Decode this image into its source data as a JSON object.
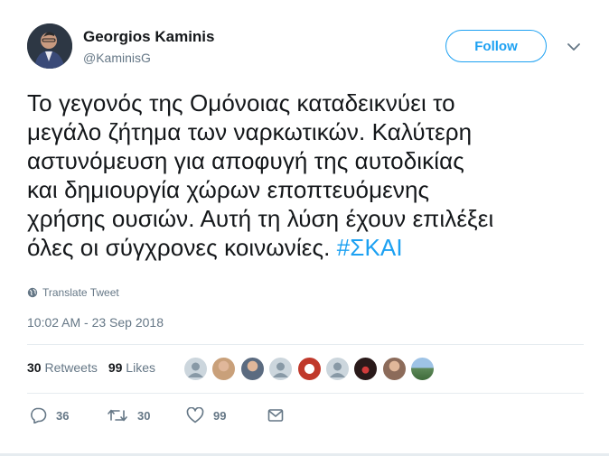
{
  "author": {
    "name": "Georgios Kaminis",
    "handle": "@KaminisG"
  },
  "follow_label": "Follow",
  "tweet": {
    "lines": [
      "Το γεγονός της Ομόνοιας καταδεικνύει το",
      "μεγάλο ζήτημα των ναρκωτικών. Καλύτερη",
      "αστυνόμευση για αποφυγή της αυτοδικίας",
      "και δημιουργία χώρων εποπτευόμενης",
      "χρήσης ουσιών. Αυτή τη λύση έχουν επιλέξει",
      "όλες οι σύγχρονες κοινωνίες."
    ],
    "hashtag": "#ΣΚΑΙ"
  },
  "translate_label": "Translate Tweet",
  "timestamp": "10:02 AM - 23 Sep 2018",
  "stats": {
    "retweets_count": "30",
    "retweets_label": "Retweets",
    "likes_count": "99",
    "likes_label": "Likes"
  },
  "liker_avatars": [
    {
      "icon": "default-avatar",
      "color": "#ccd6dd"
    },
    {
      "icon": "person-photo",
      "color": "#c9a07a"
    },
    {
      "icon": "person-photo",
      "color": "#5b6b80"
    },
    {
      "icon": "default-avatar",
      "color": "#ccd6dd"
    },
    {
      "icon": "logo-photo",
      "color": "#c0392b"
    },
    {
      "icon": "default-avatar",
      "color": "#ccd6dd"
    },
    {
      "icon": "photo-dark",
      "color": "#2a1a1a"
    },
    {
      "icon": "person-photo",
      "color": "#8c6b5a"
    },
    {
      "icon": "landscape-photo",
      "color": "#5e8a5a"
    }
  ],
  "actions": {
    "reply_count": "36",
    "retweet_count": "30",
    "like_count": "99"
  },
  "colors": {
    "accent": "#1da1f2",
    "secondary_text": "#657786",
    "primary_text": "#14171a",
    "separator": "#e6ecf0"
  }
}
